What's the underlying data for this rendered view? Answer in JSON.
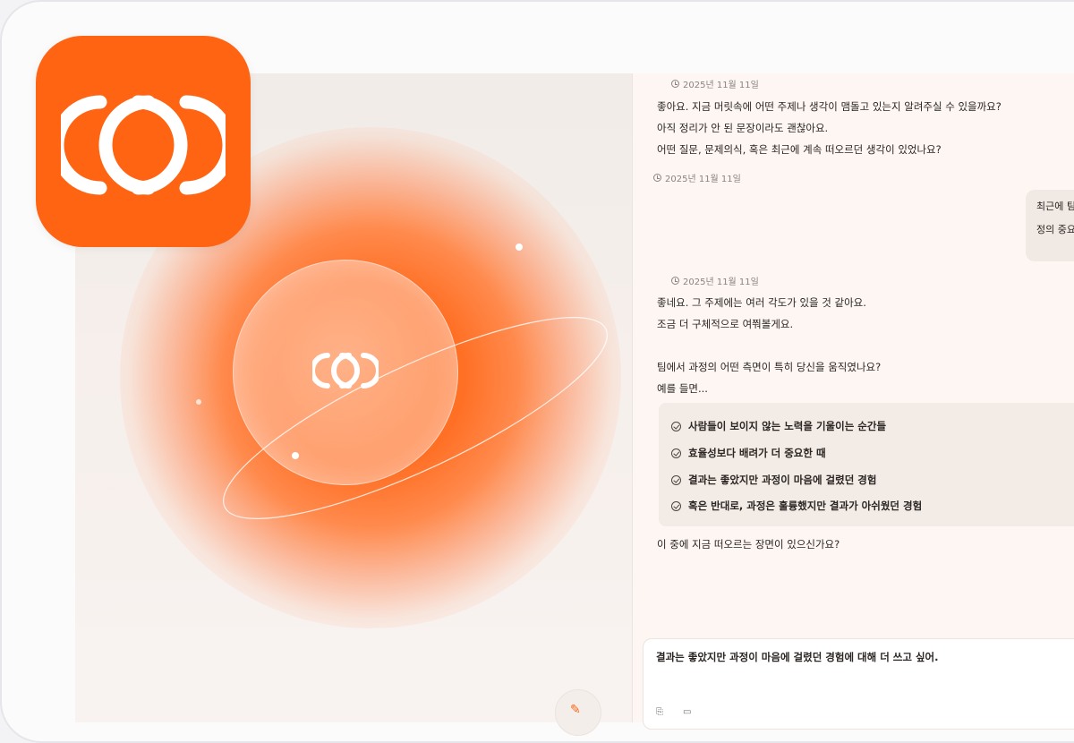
{
  "conversation": {
    "timestamp_1": "2025년 11월 11일",
    "ai_message_1": [
      "좋아요. 지금 머릿속에 어떤 주제나 생각이 맴돌고 있는지 알려주실 수 있을까요?",
      "아직 정리가 안 된 문장이라도 괜찮아요.",
      "어떤 질문, 문제의식, 혹은 최근에 계속 떠오르던 생각이 있었나요?"
    ],
    "timestamp_2": "2025년 11월 11일",
    "user_message_1": [
      "최근에 팀",
      "정의 중요"
    ],
    "timestamp_3": "2025년 11월 11일",
    "ai_message_2": [
      "좋네요. 그 주제에는 여러 각도가 있을 것 같아요.",
      "조금 더 구체적으로 여쭤볼게요.",
      "팀에서 과정의 어떤 측면이 특히 당신을 움직였나요?",
      "예를 들면..."
    ],
    "options": [
      "사람들이 보이지 않는 노력을 기울이는 순간들",
      "효율성보다 배려가 더 중요한 때",
      "결과는 좋았지만 과정이 마음에 걸렸던 경험",
      "혹은 반대로, 과정은 훌륭했지만 결과가 아쉬웠던 경험"
    ],
    "ai_question": "이 중에 지금 떠오르는 장면이 있으신가요?"
  },
  "composer": {
    "text": "결과는 좋았지만 과정이 마음에 걸렸던 경험에 대해 더 쓰고 싶어."
  },
  "icons": {
    "app_icon": "overlapping-rings-logo-icon",
    "orb_logo": "overlapping-rings-logo-icon",
    "timestamp": "clock-icon",
    "option": "check-circle-icon",
    "bottom": "note-icon"
  },
  "colors": {
    "brand_orange": "#ff6412",
    "glow": "#ff6a1a",
    "chat_bg": "#fdf6f2"
  }
}
